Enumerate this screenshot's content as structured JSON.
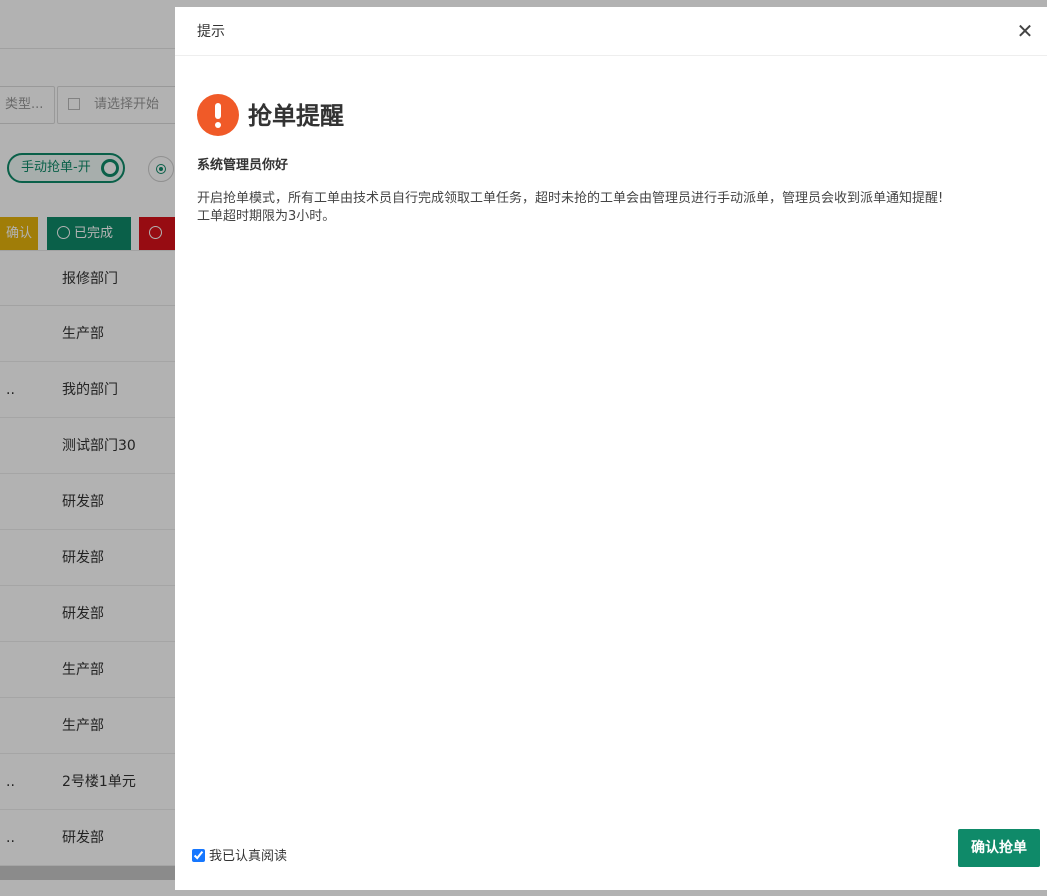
{
  "background": {
    "filter_type_text": "类型...",
    "filter_date_placeholder": "请选择开始",
    "toggle_label": "手动抢单-开",
    "status_buttons": {
      "confirm": "确认",
      "done": "已完成",
      "red": ""
    },
    "table_header": "报修部门",
    "rows": [
      {
        "ellipsis": "",
        "department": "生产部"
      },
      {
        "ellipsis": "..",
        "department": "我的部门"
      },
      {
        "ellipsis": "",
        "department": "测试部门30"
      },
      {
        "ellipsis": "",
        "department": "研发部"
      },
      {
        "ellipsis": "",
        "department": "研发部"
      },
      {
        "ellipsis": "",
        "department": "研发部"
      },
      {
        "ellipsis": "",
        "department": "生产部"
      },
      {
        "ellipsis": "",
        "department": "生产部"
      },
      {
        "ellipsis": "..",
        "department": "2号楼1单元"
      },
      {
        "ellipsis": "..",
        "department": "研发部"
      }
    ]
  },
  "modal": {
    "title": "提示",
    "close_symbol": "✕",
    "heading": "抢单提醒",
    "greeting": "系统管理员你好",
    "message_line1": "开启抢单模式，所有工单由技术员自行完成领取工单任务，超时未抢的工单会由管理员进行手动派单，管理员会收到派单通知提醒!",
    "message_line2": "工单超时期限为3小时。",
    "ack_label": "我已认真阅读",
    "ack_checked": true,
    "confirm_button": "确认抢单"
  },
  "colors": {
    "primary_green": "#0f8a69",
    "alert_orange": "#f05a28",
    "confirm_yellow": "#e6b40c",
    "danger_red": "#d9121a"
  },
  "icons": {
    "alert": "exclamation-circle-icon",
    "close": "close-icon",
    "calendar": "calendar-icon",
    "done": "check-circle-icon"
  }
}
